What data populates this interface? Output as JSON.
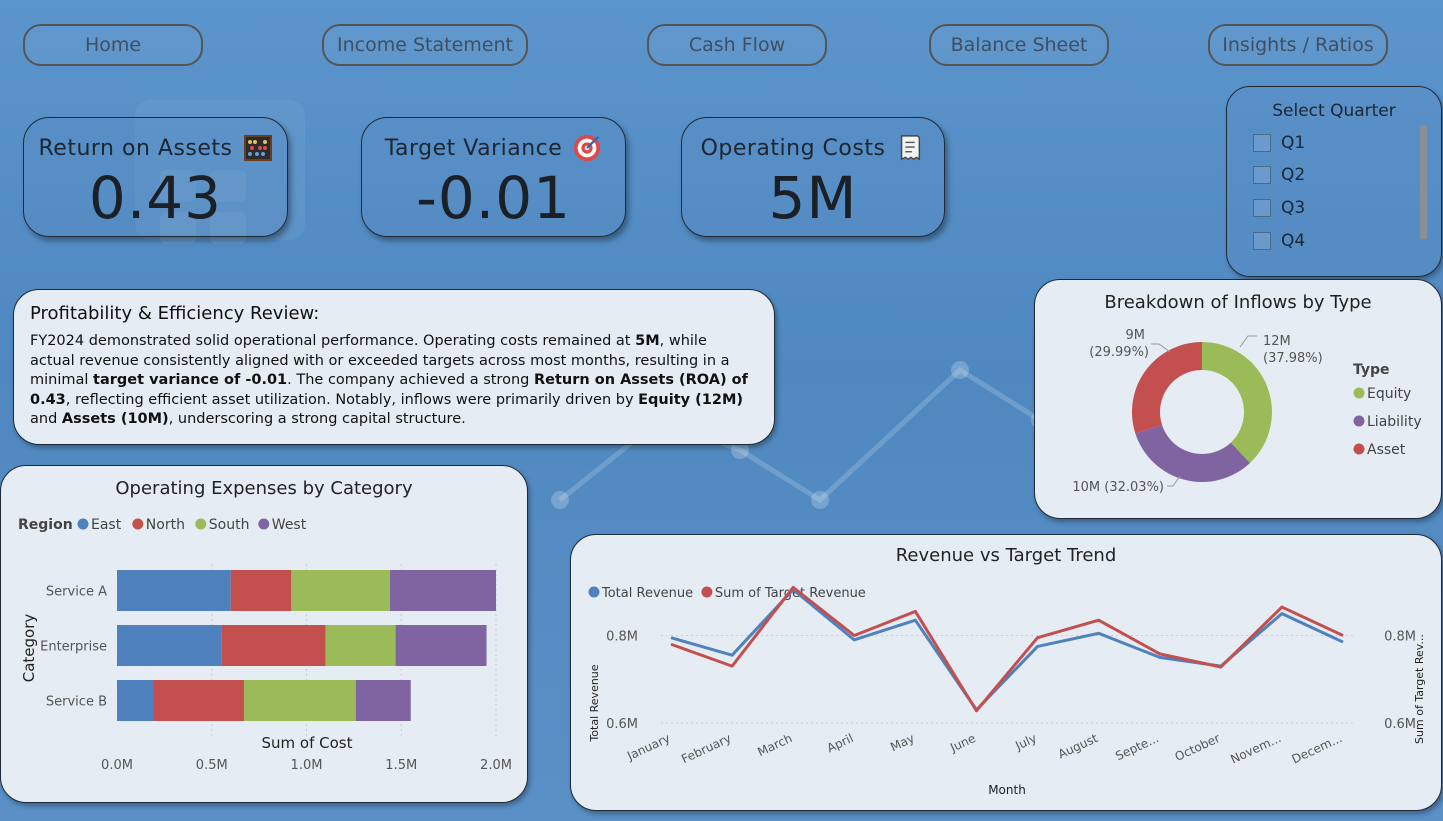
{
  "nav": {
    "home": "Home",
    "income": "Income Statement",
    "cashflow": "Cash Flow",
    "balance": "Balance Sheet",
    "insights": "Insights / Ratios"
  },
  "kpis": {
    "roa": {
      "title": "Return on Assets",
      "value": "0.43",
      "icon": "abacus-icon"
    },
    "variance": {
      "title": "Target Variance",
      "value": "-0.01",
      "icon": "target-icon"
    },
    "opcosts": {
      "title": "Operating Costs",
      "value": "5M",
      "icon": "receipt-icon"
    }
  },
  "slicer": {
    "title": "Select Quarter",
    "options": [
      "Q1",
      "Q2",
      "Q3",
      "Q4"
    ]
  },
  "review": {
    "title": "Profitability & Efficiency Review:",
    "s1": "FY2024 demonstrated solid operational performance. Operating costs remained at ",
    "b1": "5M",
    "s2": ", while actual revenue consistently aligned with or exceeded targets across most months, resulting in a minimal ",
    "b2": "target variance of -0.01",
    "s3": ". The company achieved a strong ",
    "b3": "Return on Assets (ROA) of 0.43",
    "s4": ", reflecting efficient asset utilization. Notably, inflows were primarily driven by ",
    "b4": "Equity (12M)",
    "s5": " and ",
    "b5": "Assets (10M)",
    "s6": ", underscoring a strong capital structure."
  },
  "colors": {
    "east": "#4e81bd",
    "north": "#c44f4f",
    "south": "#9bbb59",
    "west": "#8064a2",
    "equity": "#9bbb59",
    "liability": "#8064a2",
    "asset": "#c44f4f"
  },
  "chart_data": [
    {
      "type": "bar",
      "orientation": "horizontal-stacked",
      "title": "Operating Expenses by Category",
      "xlabel": "Sum of Cost",
      "ylabel": "Category",
      "legend_title": "Region",
      "categories": [
        "Service A",
        "Enterprise",
        "Service B"
      ],
      "series": [
        {
          "name": "East",
          "values": [
            0.6,
            0.55,
            0.19
          ]
        },
        {
          "name": "North",
          "values": [
            0.32,
            0.55,
            0.48
          ]
        },
        {
          "name": "South",
          "values": [
            0.52,
            0.37,
            0.59
          ]
        },
        {
          "name": "West",
          "values": [
            0.56,
            0.48,
            0.29
          ]
        }
      ],
      "xlim": [
        0,
        2.0
      ],
      "xticks": [
        "0.0M",
        "0.5M",
        "1.0M",
        "1.5M",
        "2.0M"
      ]
    },
    {
      "type": "pie",
      "title": "Breakdown of Inflows by Type",
      "legend_title": "Type",
      "slices": [
        {
          "name": "Equity",
          "value": 37.98,
          "label": "12M",
          "pct": "(37.98%)"
        },
        {
          "name": "Liability",
          "value": 32.03,
          "label": "10M (32.03%)"
        },
        {
          "name": "Asset",
          "value": 29.99,
          "label": "9M",
          "pct": "(29.99%)"
        }
      ]
    },
    {
      "type": "line",
      "title": "Revenue vs Target Trend",
      "xlabel": "Month",
      "ylabel": "Total Revenue",
      "ylabel_right": "Sum of Target Rev...",
      "x": [
        "January",
        "February",
        "March",
        "April",
        "May",
        "June",
        "July",
        "August",
        "Septe...",
        "October",
        "Novem...",
        "Decem..."
      ],
      "series": [
        {
          "name": "Total Revenue",
          "values": [
            0.795,
            0.755,
            0.905,
            0.79,
            0.835,
            0.63,
            0.775,
            0.805,
            0.75,
            0.73,
            0.85,
            0.785
          ]
        },
        {
          "name": "Sum of Target Revenue",
          "values": [
            0.78,
            0.73,
            0.91,
            0.8,
            0.855,
            0.628,
            0.795,
            0.835,
            0.758,
            0.728,
            0.865,
            0.8
          ]
        }
      ],
      "ylim": [
        0.6,
        0.92
      ],
      "yticks": [
        "0.6M",
        "0.8M"
      ]
    }
  ]
}
